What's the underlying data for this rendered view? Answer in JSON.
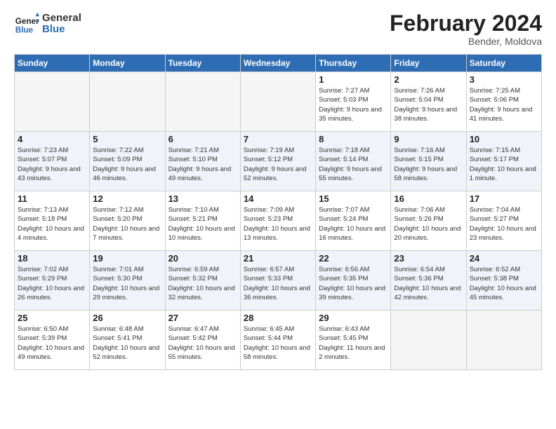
{
  "header": {
    "logo_line1": "General",
    "logo_line2": "Blue",
    "month_year": "February 2024",
    "location": "Bender, Moldova"
  },
  "days_of_week": [
    "Sunday",
    "Monday",
    "Tuesday",
    "Wednesday",
    "Thursday",
    "Friday",
    "Saturday"
  ],
  "weeks": [
    {
      "shaded": false,
      "days": [
        {
          "num": "",
          "info": ""
        },
        {
          "num": "",
          "info": ""
        },
        {
          "num": "",
          "info": ""
        },
        {
          "num": "",
          "info": ""
        },
        {
          "num": "1",
          "info": "Sunrise: 7:27 AM\nSunset: 5:03 PM\nDaylight: 9 hours\nand 35 minutes."
        },
        {
          "num": "2",
          "info": "Sunrise: 7:26 AM\nSunset: 5:04 PM\nDaylight: 9 hours\nand 38 minutes."
        },
        {
          "num": "3",
          "info": "Sunrise: 7:25 AM\nSunset: 5:06 PM\nDaylight: 9 hours\nand 41 minutes."
        }
      ]
    },
    {
      "shaded": true,
      "days": [
        {
          "num": "4",
          "info": "Sunrise: 7:23 AM\nSunset: 5:07 PM\nDaylight: 9 hours\nand 43 minutes."
        },
        {
          "num": "5",
          "info": "Sunrise: 7:22 AM\nSunset: 5:09 PM\nDaylight: 9 hours\nand 46 minutes."
        },
        {
          "num": "6",
          "info": "Sunrise: 7:21 AM\nSunset: 5:10 PM\nDaylight: 9 hours\nand 49 minutes."
        },
        {
          "num": "7",
          "info": "Sunrise: 7:19 AM\nSunset: 5:12 PM\nDaylight: 9 hours\nand 52 minutes."
        },
        {
          "num": "8",
          "info": "Sunrise: 7:18 AM\nSunset: 5:14 PM\nDaylight: 9 hours\nand 55 minutes."
        },
        {
          "num": "9",
          "info": "Sunrise: 7:16 AM\nSunset: 5:15 PM\nDaylight: 9 hours\nand 58 minutes."
        },
        {
          "num": "10",
          "info": "Sunrise: 7:15 AM\nSunset: 5:17 PM\nDaylight: 10 hours\nand 1 minute."
        }
      ]
    },
    {
      "shaded": false,
      "days": [
        {
          "num": "11",
          "info": "Sunrise: 7:13 AM\nSunset: 5:18 PM\nDaylight: 10 hours\nand 4 minutes."
        },
        {
          "num": "12",
          "info": "Sunrise: 7:12 AM\nSunset: 5:20 PM\nDaylight: 10 hours\nand 7 minutes."
        },
        {
          "num": "13",
          "info": "Sunrise: 7:10 AM\nSunset: 5:21 PM\nDaylight: 10 hours\nand 10 minutes."
        },
        {
          "num": "14",
          "info": "Sunrise: 7:09 AM\nSunset: 5:23 PM\nDaylight: 10 hours\nand 13 minutes."
        },
        {
          "num": "15",
          "info": "Sunrise: 7:07 AM\nSunset: 5:24 PM\nDaylight: 10 hours\nand 16 minutes."
        },
        {
          "num": "16",
          "info": "Sunrise: 7:06 AM\nSunset: 5:26 PM\nDaylight: 10 hours\nand 20 minutes."
        },
        {
          "num": "17",
          "info": "Sunrise: 7:04 AM\nSunset: 5:27 PM\nDaylight: 10 hours\nand 23 minutes."
        }
      ]
    },
    {
      "shaded": true,
      "days": [
        {
          "num": "18",
          "info": "Sunrise: 7:02 AM\nSunset: 5:29 PM\nDaylight: 10 hours\nand 26 minutes."
        },
        {
          "num": "19",
          "info": "Sunrise: 7:01 AM\nSunset: 5:30 PM\nDaylight: 10 hours\nand 29 minutes."
        },
        {
          "num": "20",
          "info": "Sunrise: 6:59 AM\nSunset: 5:32 PM\nDaylight: 10 hours\nand 32 minutes."
        },
        {
          "num": "21",
          "info": "Sunrise: 6:57 AM\nSunset: 5:33 PM\nDaylight: 10 hours\nand 36 minutes."
        },
        {
          "num": "22",
          "info": "Sunrise: 6:56 AM\nSunset: 5:35 PM\nDaylight: 10 hours\nand 39 minutes."
        },
        {
          "num": "23",
          "info": "Sunrise: 6:54 AM\nSunset: 5:36 PM\nDaylight: 10 hours\nand 42 minutes."
        },
        {
          "num": "24",
          "info": "Sunrise: 6:52 AM\nSunset: 5:38 PM\nDaylight: 10 hours\nand 45 minutes."
        }
      ]
    },
    {
      "shaded": false,
      "days": [
        {
          "num": "25",
          "info": "Sunrise: 6:50 AM\nSunset: 5:39 PM\nDaylight: 10 hours\nand 49 minutes."
        },
        {
          "num": "26",
          "info": "Sunrise: 6:48 AM\nSunset: 5:41 PM\nDaylight: 10 hours\nand 52 minutes."
        },
        {
          "num": "27",
          "info": "Sunrise: 6:47 AM\nSunset: 5:42 PM\nDaylight: 10 hours\nand 55 minutes."
        },
        {
          "num": "28",
          "info": "Sunrise: 6:45 AM\nSunset: 5:44 PM\nDaylight: 10 hours\nand 58 minutes."
        },
        {
          "num": "29",
          "info": "Sunrise: 6:43 AM\nSunset: 5:45 PM\nDaylight: 11 hours\nand 2 minutes."
        },
        {
          "num": "",
          "info": ""
        },
        {
          "num": "",
          "info": ""
        }
      ]
    }
  ]
}
